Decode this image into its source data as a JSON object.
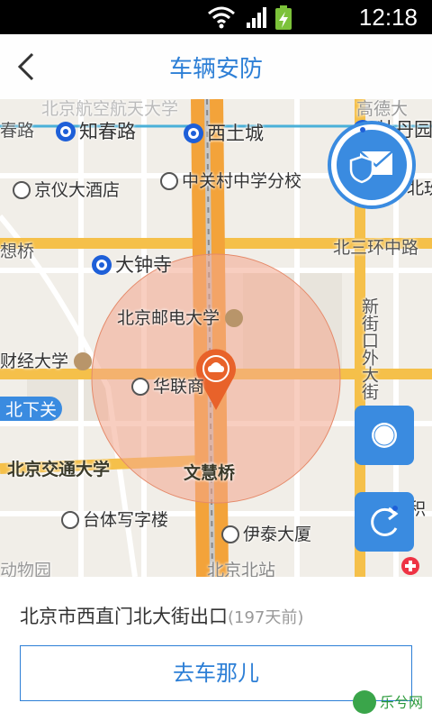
{
  "status": {
    "time": "12:18"
  },
  "header": {
    "title": "车辆安防"
  },
  "map": {
    "labels": {
      "beihang": "北京航空航天大学",
      "gaode": "高德大",
      "chunlu": "春路",
      "zhichunlu": "知春路",
      "xitucheng": "西土城",
      "mudanyuan": "牡丹园",
      "jingyi": "京仪大酒店",
      "zhongguancun": "中关村中学分校",
      "beijiao": "北玖",
      "xiangqiao": "想桥",
      "beisanhuan": "北三环中路",
      "dazhongsi": "大钟寺",
      "youdian": "北京邮电大学",
      "xinjiekou": "新街口外大街",
      "caijing": "财经大学",
      "hualian": "华联商",
      "beixiaguan": "北下关",
      "jiaotong": "北京交通大学",
      "wenhuiqiao": "文慧桥",
      "jiro": "积",
      "taiti": "台体写字楼",
      "yitai": "伊泰大厦",
      "beijingbei": "北京北站",
      "dongwuyuan": "动物园"
    }
  },
  "location": {
    "address": "北京市西直门北大街出口",
    "ago": "(197天前)"
  },
  "actions": {
    "go_label": "去车那儿"
  },
  "watermark": "乐兮网",
  "colors": {
    "accent": "#2d7fd6",
    "marker": "#e8622a",
    "circle": "#f3a68c"
  }
}
